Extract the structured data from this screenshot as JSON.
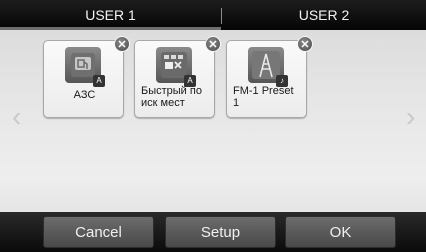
{
  "tabs": [
    {
      "label": "USER 1",
      "selected": true
    },
    {
      "label": "USER 2",
      "selected": false
    }
  ],
  "tiles": [
    {
      "label": "АЗС",
      "icon": "gas-station-icon"
    },
    {
      "label": "Быстрый по\nиск мест",
      "icon": "quick-search-icon"
    },
    {
      "label": "FM-1 Preset\n1",
      "icon": "radio-tower-icon"
    }
  ],
  "close_glyph": "✕",
  "badge_glyph": "A",
  "note_glyph": "♪",
  "buttons": {
    "cancel": "Cancel",
    "setup": "Setup",
    "ok": "OK"
  }
}
